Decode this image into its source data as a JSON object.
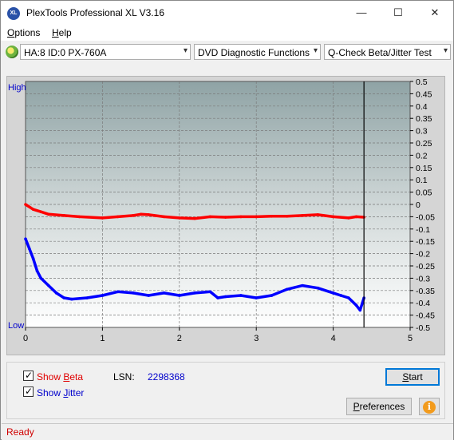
{
  "app": {
    "title": "PlexTools Professional XL V3.16",
    "icon_text": "XL"
  },
  "window_controls": {
    "minimize": "—",
    "maximize": "☐",
    "close": "✕"
  },
  "menu": {
    "items": [
      {
        "label": "Options",
        "mnemonic": "O",
        "rest": "ptions"
      },
      {
        "label": "Help",
        "mnemonic": "H",
        "rest": "elp"
      }
    ]
  },
  "toolbar": {
    "drive": "HA:8 ID:0  PX-760A",
    "function": "DVD Diagnostic Functions",
    "test": "Q-Check Beta/Jitter Test"
  },
  "chart_data": {
    "type": "line",
    "xlim": [
      0,
      5
    ],
    "x_ticks": [
      "0",
      "1",
      "2",
      "3",
      "4",
      "5"
    ],
    "ylim": [
      -0.5,
      0.5
    ],
    "y_ticks": [
      "0.5",
      "0.45",
      "0.4",
      "0.35",
      "0.3",
      "0.25",
      "0.2",
      "0.15",
      "0.1",
      "0.05",
      "0",
      "-0.05",
      "-0.1",
      "-0.15",
      "-0.2",
      "-0.25",
      "-0.3",
      "-0.35",
      "-0.4",
      "-0.45",
      "-0.5"
    ],
    "left_labels": {
      "top": "High",
      "bottom": "Low"
    },
    "end_marker_x": 4.4,
    "grid": true,
    "series": [
      {
        "color": "#ff0000",
        "x": [
          0,
          0.1,
          0.2,
          0.3,
          0.5,
          0.7,
          1.0,
          1.2,
          1.4,
          1.5,
          1.6,
          1.8,
          2.0,
          2.2,
          2.4,
          2.6,
          2.8,
          3.0,
          3.2,
          3.4,
          3.6,
          3.8,
          4.0,
          4.2,
          4.3,
          4.4
        ],
        "y": [
          0.0,
          -0.02,
          -0.03,
          -0.04,
          -0.045,
          -0.05,
          -0.055,
          -0.05,
          -0.045,
          -0.04,
          -0.042,
          -0.05,
          -0.055,
          -0.057,
          -0.05,
          -0.052,
          -0.05,
          -0.05,
          -0.048,
          -0.048,
          -0.045,
          -0.042,
          -0.05,
          -0.055,
          -0.05,
          -0.052
        ]
      },
      {
        "color": "#0000ff",
        "x": [
          0,
          0.05,
          0.1,
          0.15,
          0.2,
          0.3,
          0.4,
          0.5,
          0.6,
          0.8,
          1.0,
          1.2,
          1.4,
          1.6,
          1.8,
          2.0,
          2.2,
          2.4,
          2.5,
          2.6,
          2.8,
          3.0,
          3.2,
          3.4,
          3.6,
          3.8,
          4.0,
          4.1,
          4.2,
          4.3,
          4.35,
          4.4
        ],
        "y": [
          -0.14,
          -0.18,
          -0.22,
          -0.27,
          -0.3,
          -0.33,
          -0.36,
          -0.38,
          -0.385,
          -0.38,
          -0.37,
          -0.355,
          -0.36,
          -0.37,
          -0.36,
          -0.37,
          -0.36,
          -0.355,
          -0.38,
          -0.375,
          -0.37,
          -0.38,
          -0.37,
          -0.345,
          -0.33,
          -0.34,
          -0.36,
          -0.37,
          -0.38,
          -0.41,
          -0.43,
          -0.38
        ]
      }
    ]
  },
  "controls": {
    "show_beta": {
      "prefix": "Show ",
      "mnemonic": "B",
      "rest": "eta",
      "checked": true,
      "color": "#e00000"
    },
    "show_jitter": {
      "prefix": "Show ",
      "mnemonic": "J",
      "rest": "itter",
      "checked": true,
      "color": "#0000cc"
    },
    "lsn_label": "LSN:",
    "lsn_value": "2298368",
    "start_label": {
      "mnemonic": "S",
      "rest": "tart"
    },
    "preferences_label": {
      "mnemonic": "P",
      "rest": "references"
    }
  },
  "status": {
    "text": "Ready"
  }
}
